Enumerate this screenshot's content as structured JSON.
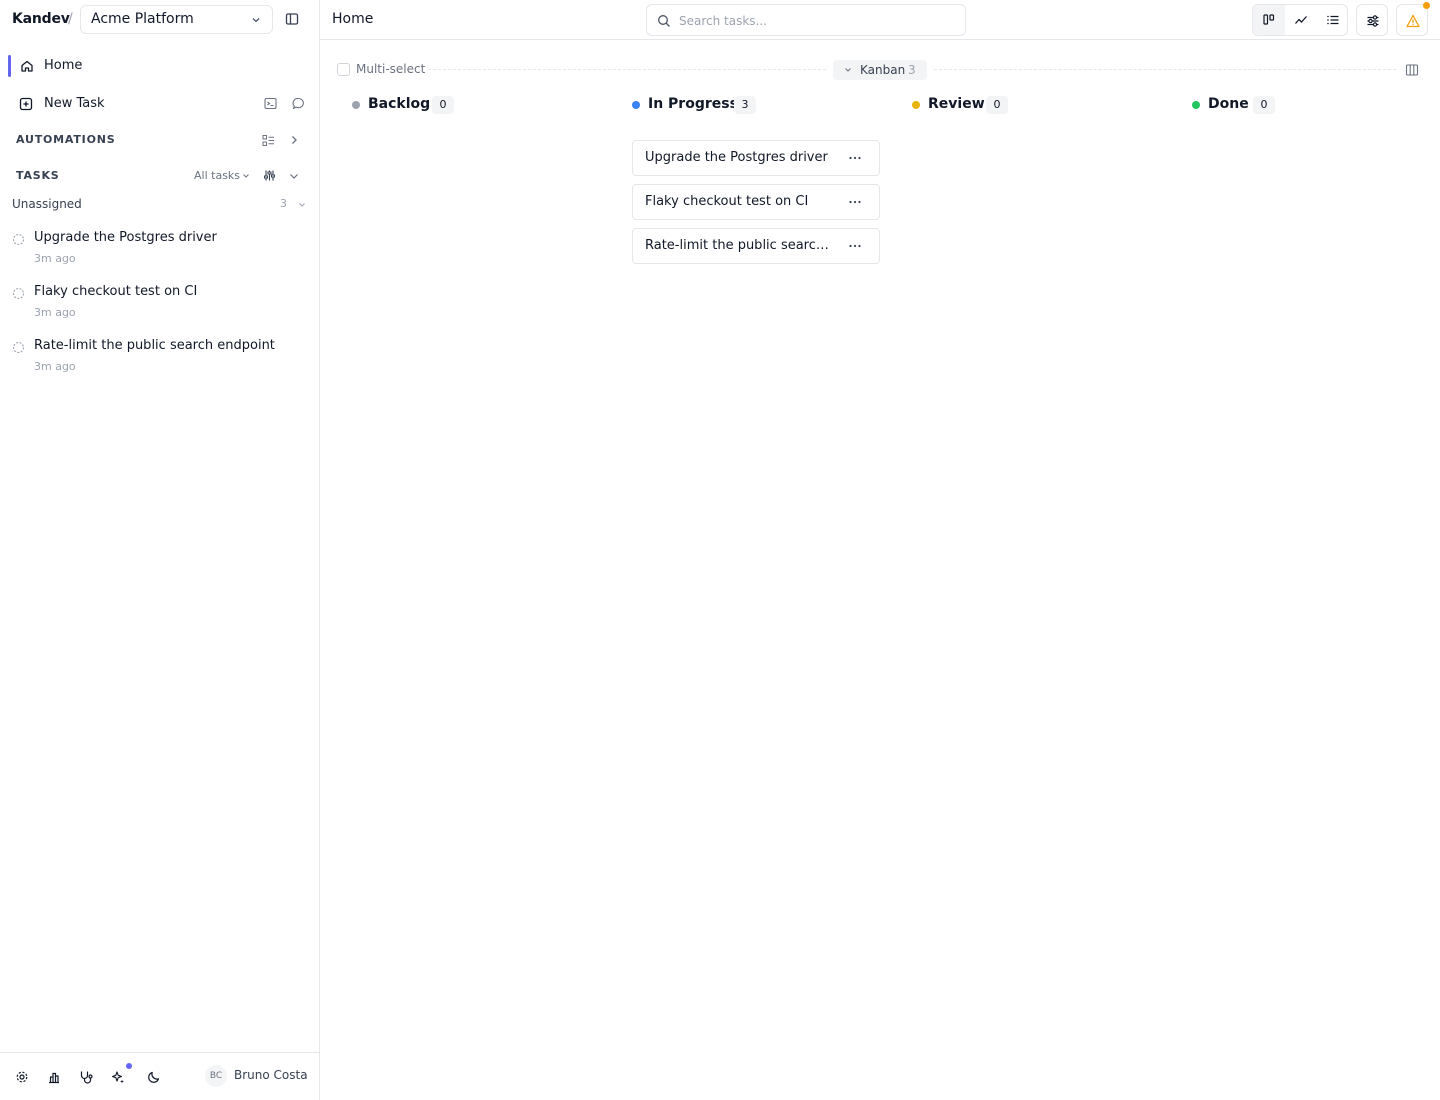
{
  "app": {
    "brand": "Kandev",
    "separator": "/",
    "workspace": "Acme Platform"
  },
  "sidebar": {
    "nav": {
      "home_label": "Home",
      "new_task_label": "New Task"
    },
    "sections": {
      "automations_label": "AUTOMATIONS",
      "tasks_label": "TASKS",
      "tasks_filter": "All tasks"
    },
    "group": {
      "label": "Unassigned",
      "count": "3"
    },
    "tasks": [
      {
        "title": "Upgrade the Postgres driver",
        "ago": "3m ago"
      },
      {
        "title": "Flaky checkout test on CI",
        "ago": "3m ago"
      },
      {
        "title": "Rate-limit the public search endpoint",
        "ago": "3m ago"
      }
    ],
    "footer": {
      "user_initials": "BC",
      "user_name": "Bruno Costa"
    }
  },
  "header": {
    "title": "Home",
    "search_placeholder": "Search tasks..."
  },
  "toolbar": {
    "multiselect_label": "Multi-select",
    "view_label": "Kanban",
    "view_count": "3"
  },
  "board": {
    "columns": [
      {
        "title": "Backlog",
        "count": "0",
        "color": "#9ca3af",
        "cards": []
      },
      {
        "title": "In Progress",
        "count": "3",
        "color": "#3b82f6",
        "cards": [
          {
            "title": "Upgrade the Postgres driver"
          },
          {
            "title": "Flaky checkout test on CI"
          },
          {
            "title": "Rate-limit the public search endpoint"
          }
        ]
      },
      {
        "title": "Review",
        "count": "0",
        "color": "#eab308",
        "cards": []
      },
      {
        "title": "Done",
        "count": "0",
        "color": "#22c55e",
        "cards": []
      }
    ]
  },
  "colors": {
    "accent": "#6366f1",
    "warning": "#f59e0b"
  }
}
